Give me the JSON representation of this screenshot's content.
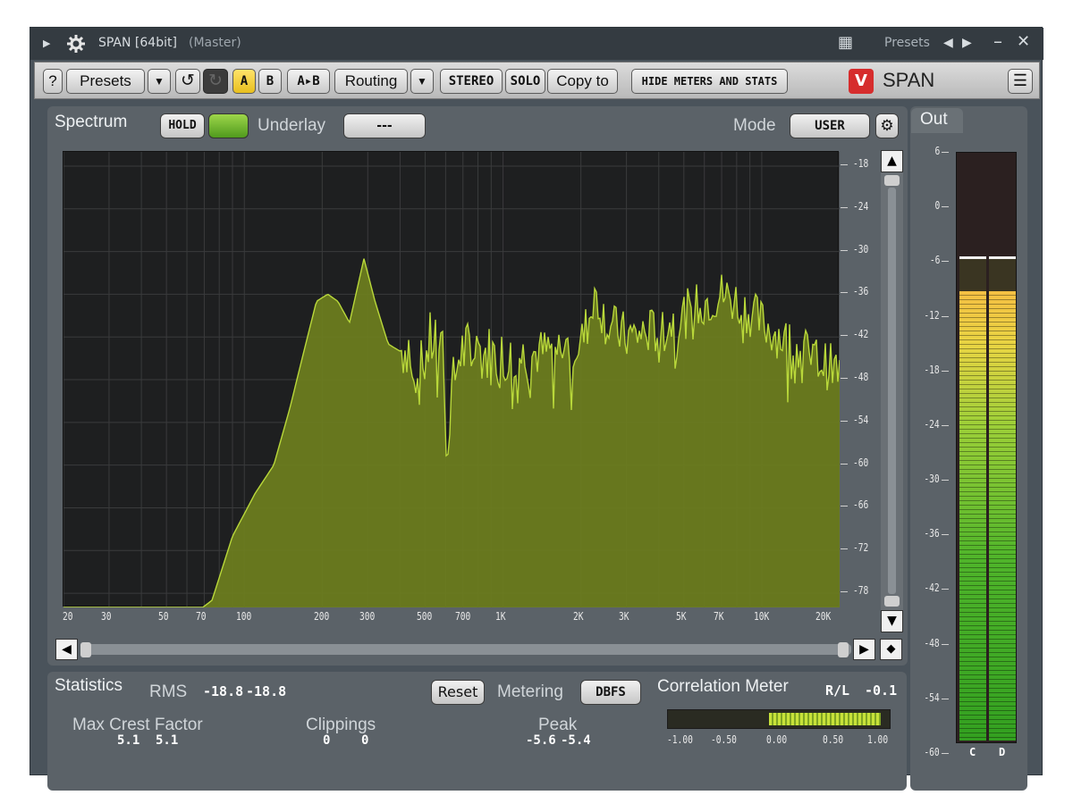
{
  "titlebar": {
    "plugin_name": "SPAN [64bit]",
    "target": "(Master)",
    "presets_label": "Presets"
  },
  "toolbar": {
    "help": "?",
    "presets": "Presets",
    "ab_a": "A",
    "ab_b": "B",
    "ab_copy": "A▸B",
    "routing": "Routing",
    "stereo": "STEREO",
    "solo": "SOLO",
    "copy_to": "Copy to",
    "hide_meters": "HIDE METERS AND STATS",
    "logo_text": "SPAN"
  },
  "spectrum": {
    "label": "Spectrum",
    "hold": "HOLD",
    "underlay_label": "Underlay",
    "underlay_value": "---",
    "mode_label": "Mode",
    "mode_value": "USER",
    "db_ticks": [
      "-18",
      "-24",
      "-30",
      "-36",
      "-42",
      "-48",
      "-54",
      "-60",
      "-66",
      "-72",
      "-78"
    ],
    "freq_ticks": [
      "20",
      "30",
      "50",
      "70",
      "100",
      "200",
      "300",
      "500",
      "700",
      "1K",
      "2K",
      "3K",
      "5K",
      "7K",
      "10K",
      "20K"
    ],
    "fill_color": "#6e7f1e",
    "line_color": "#b9d83a"
  },
  "out": {
    "label": "Out",
    "scale": [
      "6",
      "0",
      "-6",
      "-12",
      "-18",
      "-24",
      "-30",
      "-36",
      "-42",
      "-48",
      "-54",
      "-60"
    ],
    "channels": [
      "C",
      "D"
    ],
    "level_db": -9.5,
    "peak_db": -5.6
  },
  "stats": {
    "label": "Statistics",
    "rms_label": "RMS",
    "rms_l": "-18.8",
    "rms_r": "-18.8",
    "reset": "Reset",
    "metering_label": "Metering",
    "metering_value": "DBFS",
    "crest_label": "Max Crest Factor",
    "crest_l": "5.1",
    "crest_r": "5.1",
    "clip_label": "Clippings",
    "clip_l": "0",
    "clip_r": "0",
    "peak_label": "Peak",
    "peak_l": "-5.6",
    "peak_r": "-5.4"
  },
  "correlation": {
    "label": "Correlation Meter",
    "mode": "R/L",
    "value": "-0.1",
    "ticks": [
      "-1.00",
      "-0.50",
      "0.00",
      "0.50",
      "1.00"
    ]
  }
}
